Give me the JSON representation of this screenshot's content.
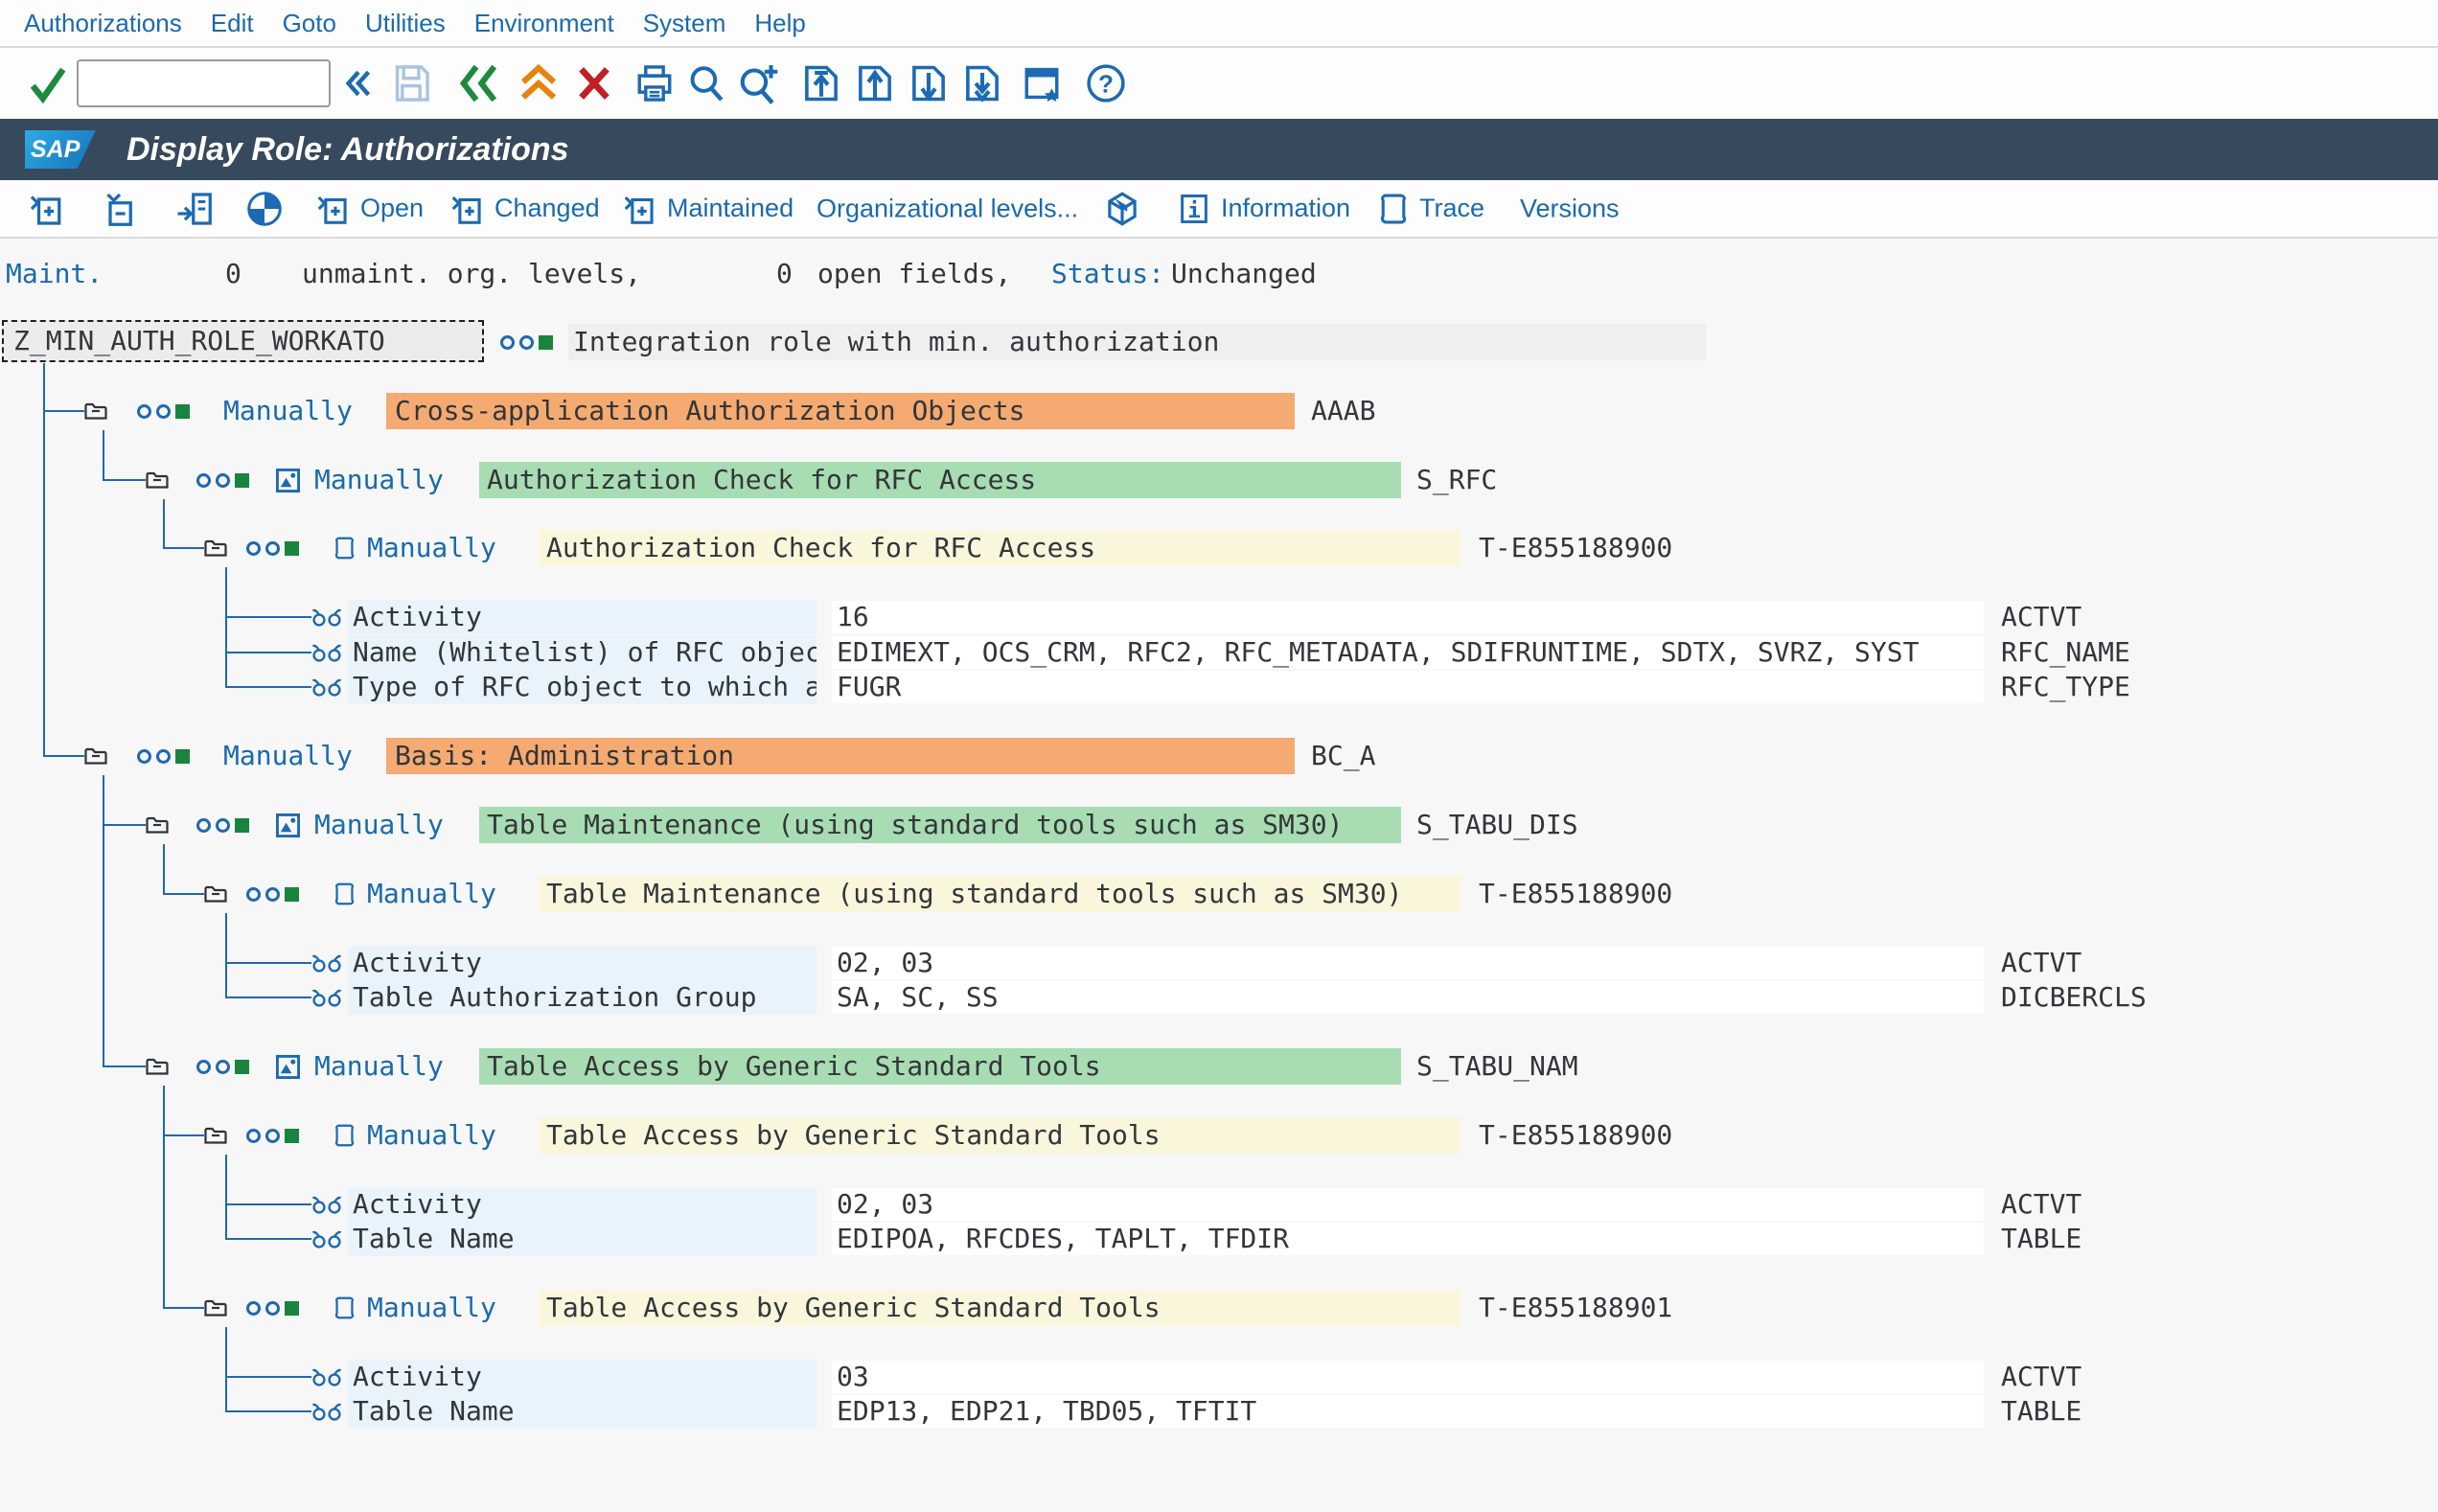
{
  "menu_bar": {
    "items": [
      "Authorizations",
      "Edit",
      "Goto",
      "Utilities",
      "Environment",
      "System",
      "Help"
    ]
  },
  "toolbar": {
    "command_field_value": "",
    "icons": [
      "confirm-check-icon",
      "command-field",
      "collapse-command-icon",
      "save-icon",
      "back-icon",
      "exit-icon",
      "cancel-icon",
      "print-icon",
      "find-icon",
      "find-next-icon",
      "first-page-icon",
      "previous-page-icon",
      "next-page-icon",
      "last-page-icon",
      "new-session-icon",
      "help-icon"
    ]
  },
  "title_bar": {
    "logo": "SAP",
    "title": "Display Role: Authorizations"
  },
  "app_toolbar": {
    "buttons": [
      {
        "icon": "expand-node-icon",
        "label": ""
      },
      {
        "icon": "collapse-node-icon",
        "label": ""
      },
      {
        "icon": "where-used-icon",
        "label": ""
      },
      {
        "icon": "harvey-ball-icon",
        "label": ""
      },
      {
        "icon": "expand-open-icon",
        "label": "Open"
      },
      {
        "icon": "expand-changed-icon",
        "label": "Changed"
      },
      {
        "icon": "expand-maintained-icon",
        "label": "Maintained"
      },
      {
        "icon": "",
        "label": "Organizational levels..."
      },
      {
        "icon": "package-icon",
        "label": ""
      },
      {
        "icon": "information-icon",
        "label": "Information"
      },
      {
        "icon": "trace-icon",
        "label": "Trace"
      },
      {
        "icon": "",
        "label": "Versions"
      }
    ]
  },
  "status_line": {
    "maint_label": "Maint.",
    "unmaint_count": "0",
    "unmaint_text": "unmaint. org. levels,",
    "open_count": "0",
    "open_text": "open fields,",
    "status_label": "Status:",
    "status_value": "Unchanged"
  },
  "tree": {
    "root": {
      "name": "Z_MIN_AUTH_ROLE_WORKATO",
      "status": "green",
      "description": "Integration role with min. authorization"
    },
    "rows": [
      {
        "type": "class",
        "label": "Manually",
        "text": "Cross-application Authorization Objects",
        "code": "AAAB",
        "status": "green"
      },
      {
        "type": "object",
        "label": "Manually",
        "text": "Authorization Check for RFC Access",
        "code": "S_RFC",
        "status": "green"
      },
      {
        "type": "auth",
        "label": "Manually",
        "text": "Authorization Check for RFC Access",
        "code": "T-E855188900",
        "status": "green"
      },
      {
        "type": "field",
        "text": "Activity",
        "value": "16",
        "code": "ACTVT"
      },
      {
        "type": "field",
        "text": "Name (Whitelist) of RFC object",
        "value": "EDIMEXT, OCS_CRM, RFC2, RFC_METADATA, SDIFRUNTIME, SDTX, SVRZ, SYST",
        "code": "RFC_NAME"
      },
      {
        "type": "field",
        "text": "Type of RFC object to which ac",
        "value": "FUGR",
        "code": "RFC_TYPE"
      },
      {
        "type": "class",
        "label": "Manually",
        "text": "Basis: Administration",
        "code": "BC_A",
        "status": "green"
      },
      {
        "type": "object",
        "label": "Manually",
        "text": "Table Maintenance (using standard tools such as SM30)",
        "code": "S_TABU_DIS",
        "status": "green"
      },
      {
        "type": "auth",
        "label": "Manually",
        "text": "Table Maintenance (using standard tools such as SM30)",
        "code": "T-E855188900",
        "status": "green"
      },
      {
        "type": "field",
        "text": "Activity",
        "value": "02, 03",
        "code": "ACTVT"
      },
      {
        "type": "field",
        "text": "Table Authorization Group",
        "value": "SA, SC, SS",
        "code": "DICBERCLS"
      },
      {
        "type": "object",
        "label": "Manually",
        "text": "Table Access by Generic Standard Tools",
        "code": "S_TABU_NAM",
        "status": "green"
      },
      {
        "type": "auth",
        "label": "Manually",
        "text": "Table Access by Generic Standard Tools",
        "code": "T-E855188900",
        "status": "green"
      },
      {
        "type": "field",
        "text": "Activity",
        "value": "02, 03",
        "code": "ACTVT"
      },
      {
        "type": "field",
        "text": "Table Name",
        "value": "EDIPOA, RFCDES, TAPLT, TFDIR",
        "code": "TABLE"
      },
      {
        "type": "auth",
        "label": "Manually",
        "text": "Table Access by Generic Standard Tools",
        "code": "T-E855188901",
        "status": "green"
      },
      {
        "type": "field",
        "text": "Activity",
        "value": "03",
        "code": "ACTVT"
      },
      {
        "type": "field",
        "text": "Table Name",
        "value": "EDP13, EDP21, TBD05, TFTIT",
        "code": "TABLE"
      }
    ],
    "colors": {
      "class_bg": "#f4aa70",
      "object_bg": "#a8dcb2",
      "auth_bg": "#faf6dc",
      "field_label_bg": "#e9f3fb",
      "line": "#2068b0",
      "green_status": "#18843e"
    }
  }
}
